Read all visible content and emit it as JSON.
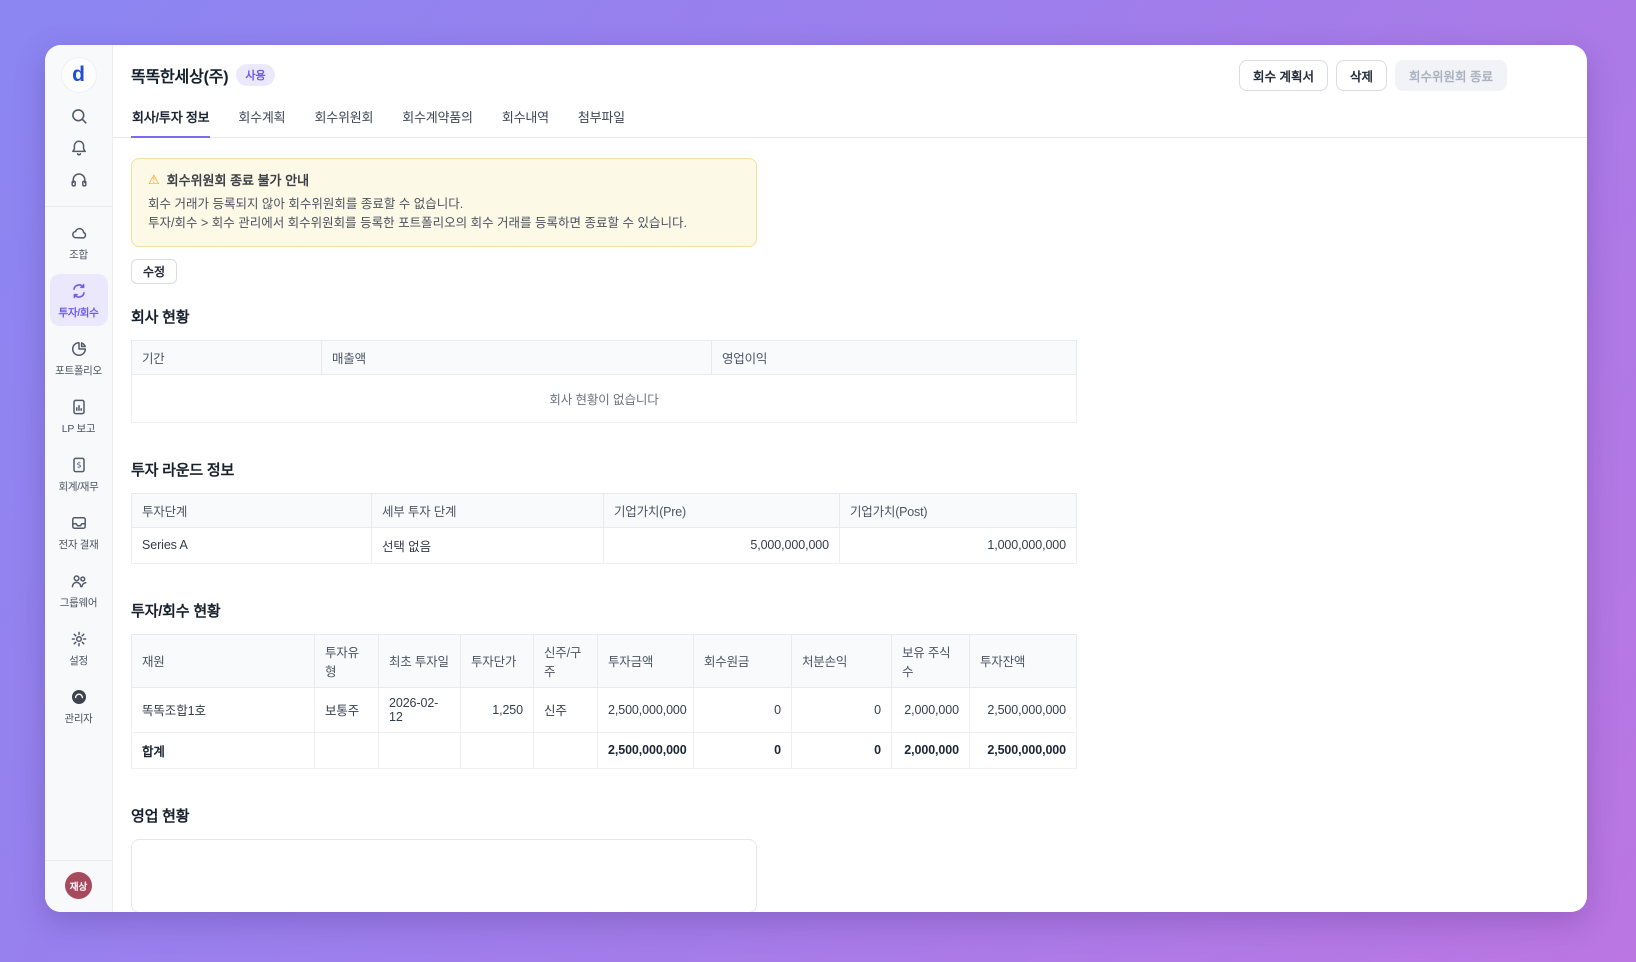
{
  "window": {
    "logo": "d",
    "title": "똑똑한세상(주)",
    "status_badge": "사용",
    "actions": {
      "plan_doc": "회수 계획서",
      "delete": "삭제",
      "close_committee": "회수위원회 종료"
    },
    "tabs": [
      "회사/투자 정보",
      "회수계획",
      "회수위원회",
      "회수계약품의",
      "회수내역",
      "첨부파일"
    ]
  },
  "sidebar": {
    "items": [
      {
        "label": "조합"
      },
      {
        "label": "투자/회수"
      },
      {
        "label": "포트폴리오"
      },
      {
        "label": "LP 보고"
      },
      {
        "label": "회계/재무"
      },
      {
        "label": "전자 결재"
      },
      {
        "label": "그룹웨어"
      },
      {
        "label": "설정"
      },
      {
        "label": "관리자"
      }
    ],
    "avatar": "재상"
  },
  "notice": {
    "icon": "⚠",
    "title": "회수위원회 종료 불가 안내",
    "line1": "회수 거래가 등록되지 않아 회수위원회를 종료할 수 없습니다.",
    "line2": "투자/회수 > 회수 관리에서 회수위원회를 등록한 포트폴리오의 회수 거래를 등록하면 종료할 수 있습니다."
  },
  "edit_button": "수정",
  "company_section": {
    "title": "회사 현황",
    "columns": [
      "기간",
      "매출액",
      "영업이익"
    ],
    "empty_text": "회사 현황이 없습니다"
  },
  "round_section": {
    "title": "투자 라운드 정보",
    "columns": [
      "투자단계",
      "세부 투자 단계",
      "기업가치(Pre)",
      "기업가치(Post)"
    ],
    "rows": [
      [
        "Series A",
        "선택 없음",
        "5,000,000,000",
        "1,000,000,000"
      ]
    ]
  },
  "invest_section": {
    "title": "투자/회수 현황",
    "columns": [
      "재원",
      "투자유형",
      "최초 투자일",
      "투자단가",
      "신주/구주",
      "투자금액",
      "회수원금",
      "처분손익",
      "보유 주식 수",
      "투자잔액"
    ],
    "rows": [
      [
        "똑똑조합1호",
        "보통주",
        "2026-02-12",
        "1,250",
        "신주",
        "2,500,000,000",
        "0",
        "0",
        "2,000,000",
        "2,500,000,000"
      ]
    ],
    "total_row": [
      "합계",
      "",
      "",
      "",
      "",
      "2,500,000,000",
      "0",
      "0",
      "2,000,000",
      "2,500,000,000"
    ]
  },
  "sales_section": {
    "title": "영업 현황",
    "content": ""
  },
  "colors": {
    "accent": "#7a6bf0",
    "badge_bg": "#ece9fd",
    "notice_bg": "#fdf9e7",
    "notice_border": "#f3dfa1",
    "warning": "#f59e0b",
    "avatar_bg": "#a84a5e",
    "logo_blue": "#1d4fd8"
  }
}
